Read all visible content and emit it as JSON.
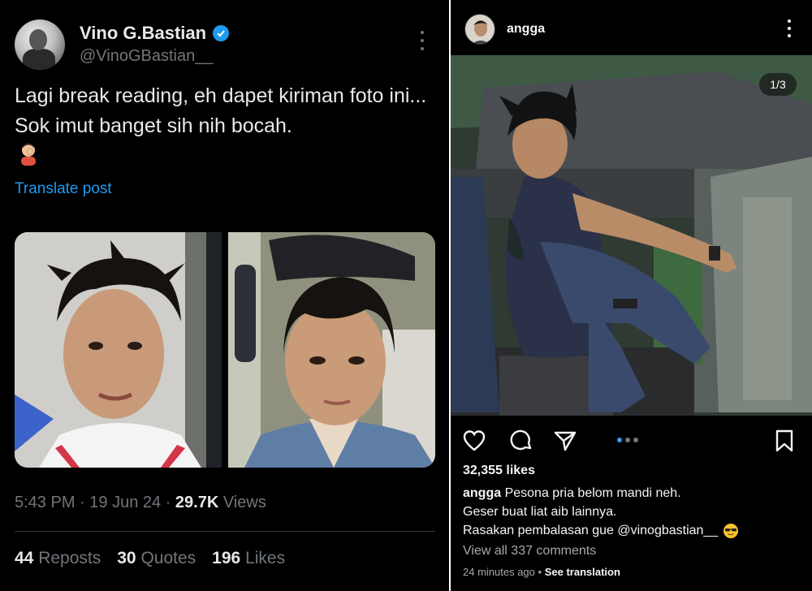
{
  "twitter": {
    "display_name": "Vino G.Bastian",
    "handle": "@VinoGBastian__",
    "text": "Lagi break reading, eh dapet kiriman foto ini... Sok imut banget sih nih bocah.",
    "emoji_icon": "man-facepalming-emoji",
    "translate_label": "Translate post",
    "time": "5:43 PM",
    "date": "19 Jun 24",
    "views_count": "29.7K",
    "views_label": "Views",
    "reposts_count": "44",
    "reposts_label": "Reposts",
    "quotes_count": "30",
    "quotes_label": "Quotes",
    "likes_count": "196",
    "likes_label": "Likes",
    "accent_color": "#1d9bf0"
  },
  "instagram": {
    "username": "angga",
    "image_counter": "1/3",
    "likes": "32,355 likes",
    "caption_user": "angga",
    "caption_line1": "Pesona pria belom mandi neh.",
    "caption_line2": "Geser buat liat aib lainnya.",
    "caption_line3": "Rasakan pembalasan gue @vinogbastian__",
    "caption_emoji_icon": "sunglasses-emoji",
    "view_comments": "View all 337 comments",
    "time_ago": "24 minutes ago",
    "see_translation": "See translation",
    "carousel_active_index": 1,
    "carousel_count": 3,
    "accent_color": "#3897f0"
  }
}
